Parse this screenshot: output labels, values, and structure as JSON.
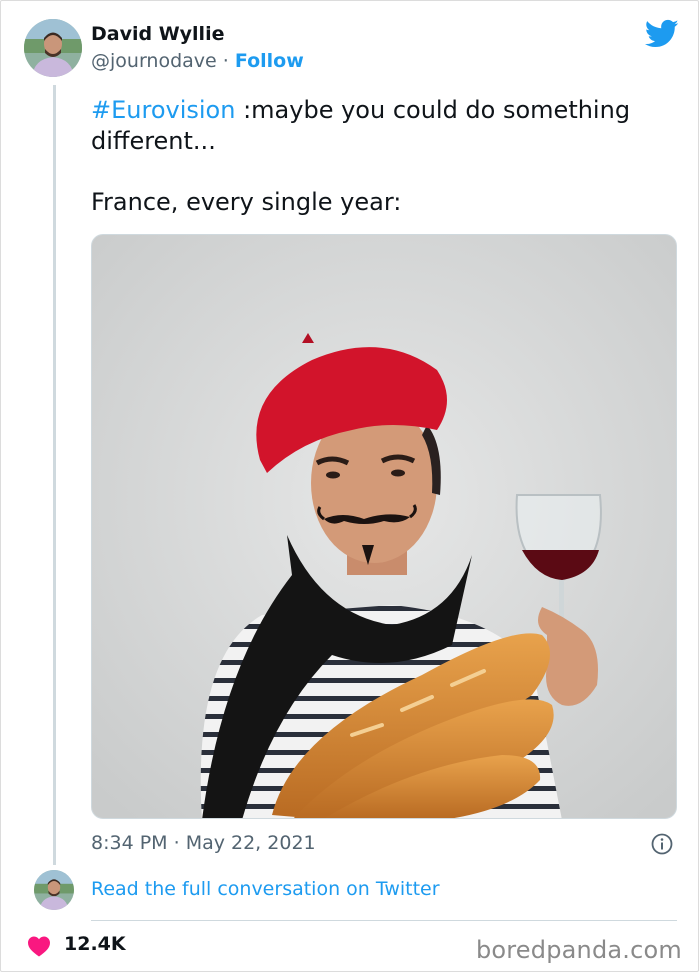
{
  "author": {
    "name": "David Wyllie",
    "handle": "@journodave",
    "separator": " · ",
    "follow_label": "Follow"
  },
  "icons": {
    "brand": "twitter-bird-icon",
    "info": "info-icon",
    "like": "heart-icon"
  },
  "tweet": {
    "hashtag": "#Eurovision",
    "text_after_hashtag": " :maybe you could do something",
    "text_line2": "different...",
    "text_para2": "France, every single year:"
  },
  "meta": {
    "time": "8:34 PM",
    "separator": " · ",
    "date": "May 22, 2021"
  },
  "read_more_label": "Read the full conversation on Twitter",
  "likes_count": "12.4K",
  "watermark": "boredpanda.com",
  "colors": {
    "link": "#1d9bf0",
    "heart": "#f91880",
    "text": "#0f1419",
    "muted": "#536471"
  }
}
